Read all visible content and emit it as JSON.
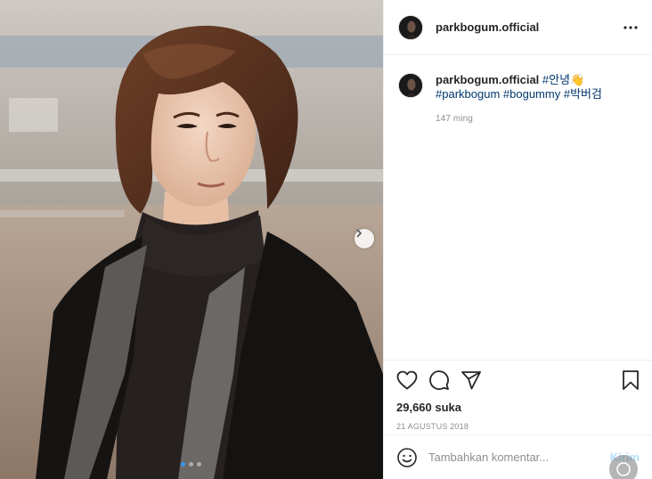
{
  "post": {
    "username": "parkbogum.official",
    "caption_greeting": "#안녕",
    "caption_emoji": "👋",
    "hashtags": [
      "#parkbogum",
      "#bogummy",
      "#박버검"
    ],
    "caption_time": "147 ming",
    "likes_count": "29,660",
    "likes_label": "suka",
    "date": "21 AGUSTUS 2018"
  },
  "carousel": {
    "current_index": 1,
    "total": 3
  },
  "comment": {
    "placeholder": "Tambahkan komentar...",
    "send_label": "Kirim"
  },
  "icons": {
    "more": "more-horizontal-icon",
    "like": "heart-icon",
    "comment": "comment-bubble-icon",
    "share": "paper-plane-icon",
    "save": "bookmark-icon",
    "emoji": "smiley-icon",
    "next": "chevron-right-icon"
  },
  "colors": {
    "hashtag": "#00376b",
    "active_dot": "#3897f0",
    "send_disabled": "#b2dffc"
  }
}
